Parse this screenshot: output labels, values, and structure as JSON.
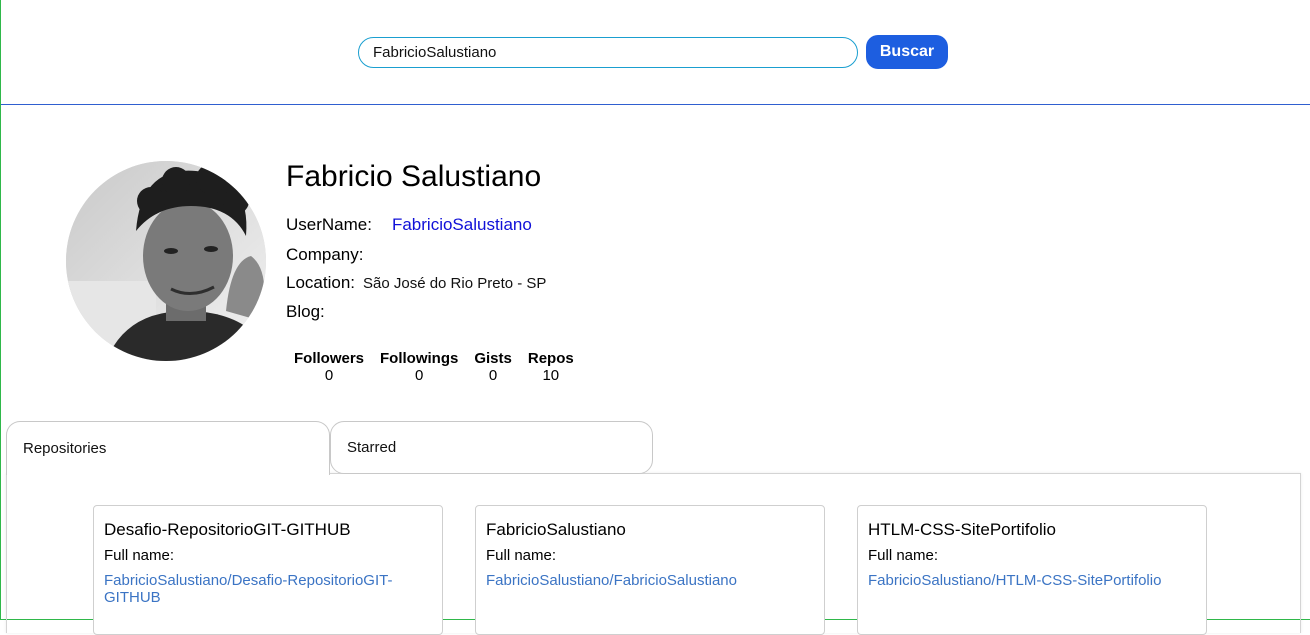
{
  "search": {
    "value": "FabricioSalustiano",
    "button_label": "Buscar"
  },
  "profile": {
    "name": "Fabricio Salustiano",
    "username_label": "UserName:",
    "username": "FabricioSalustiano",
    "company_label": "Company:",
    "company": "",
    "location_label": "Location:",
    "location": "São José do Rio Preto - SP",
    "blog_label": "Blog:",
    "blog": ""
  },
  "stats": [
    {
      "label": "Followers",
      "value": "0"
    },
    {
      "label": "Followings",
      "value": "0"
    },
    {
      "label": "Gists",
      "value": "0"
    },
    {
      "label": "Repos",
      "value": "10"
    }
  ],
  "tabs": [
    {
      "label": "Repositories",
      "active": true
    },
    {
      "label": "Starred",
      "active": false
    }
  ],
  "repos": [
    {
      "name": "Desafio-RepositorioGIT-GITHUB",
      "full_name_label": "Full name:",
      "full_name": "FabricioSalustiano/Desafio-RepositorioGIT-GITHUB"
    },
    {
      "name": "FabricioSalustiano",
      "full_name_label": "Full name:",
      "full_name": "FabricioSalustiano/FabricioSalustiano"
    },
    {
      "name": "HTLM-CSS-SitePortifolio",
      "full_name_label": "Full name:",
      "full_name": "FabricioSalustiano/HTLM-CSS-SitePortifolio"
    }
  ],
  "colors": {
    "accent": "#1d5ee0",
    "link": "#1010d8",
    "repo_link": "#3b74c4",
    "input_border": "#1a9fd0"
  }
}
